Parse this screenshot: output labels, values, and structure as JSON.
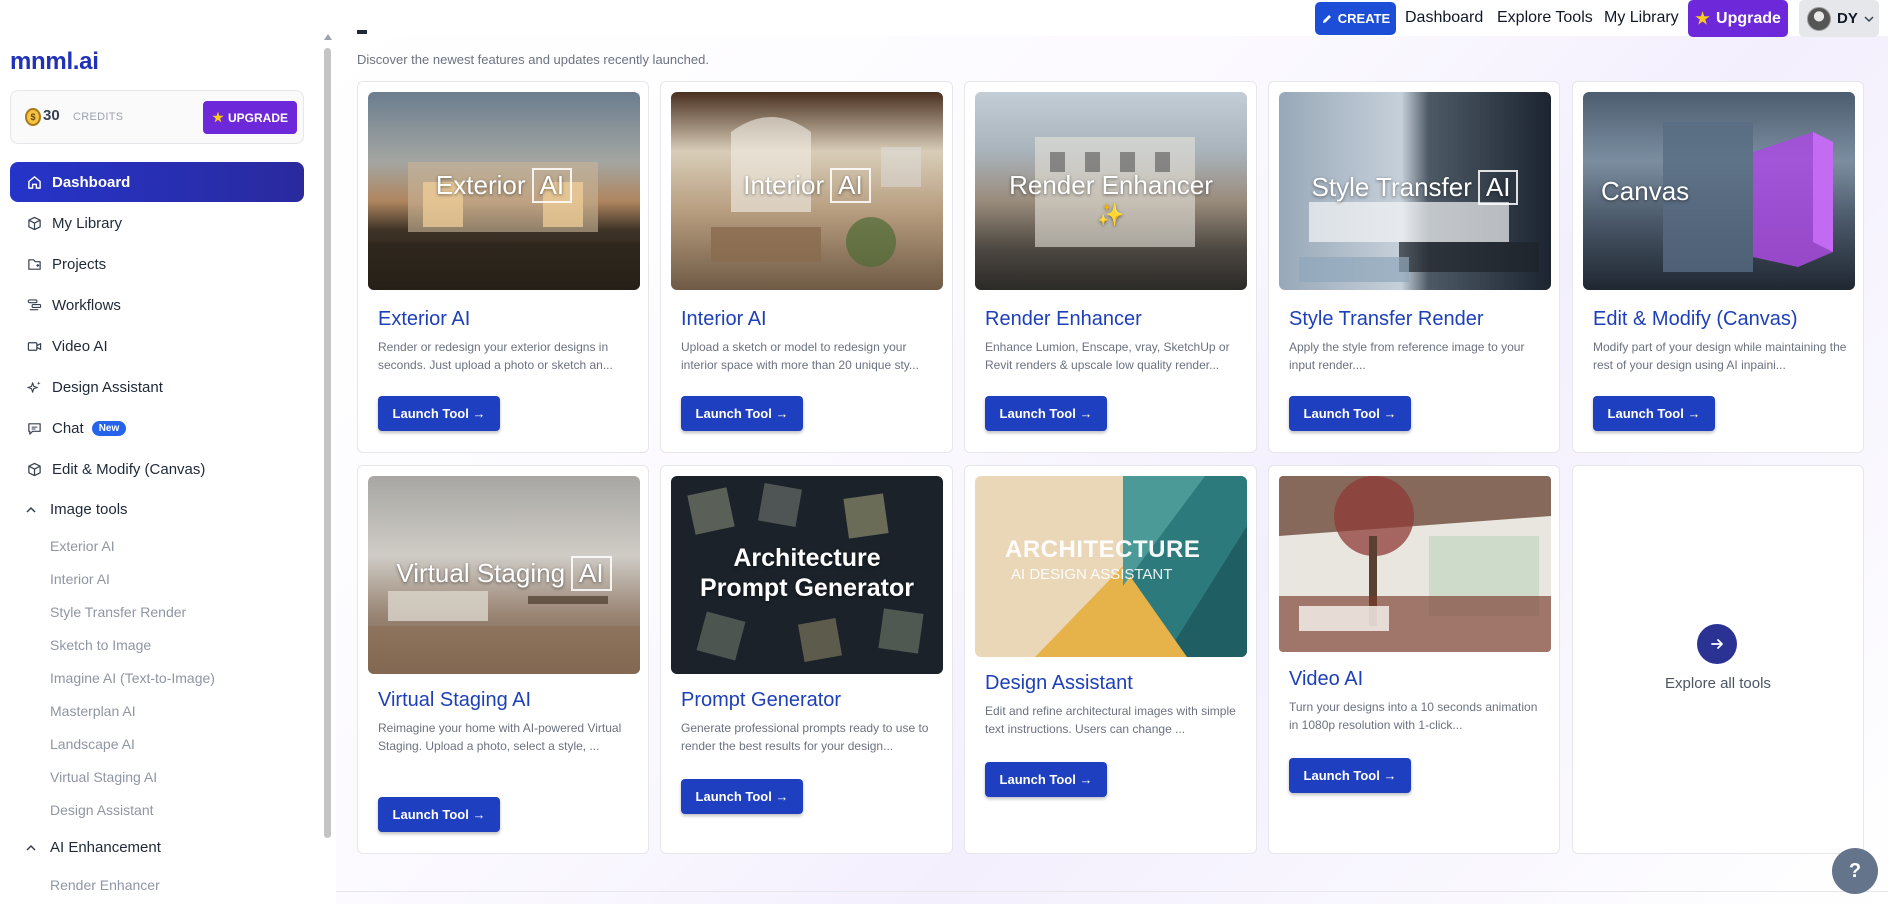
{
  "app": {
    "logo": "mnml.ai"
  },
  "credits": {
    "amount": "30",
    "label": "CREDITS",
    "upgrade_label": "UPGRADE"
  },
  "topbar": {
    "create_label": "CREATE",
    "links": [
      "Dashboard",
      "Explore Tools",
      "My Library"
    ],
    "upgrade_label": "Upgrade",
    "user_initials": "DY"
  },
  "sidebar": {
    "items": [
      {
        "label": "Dashboard",
        "icon": "home-icon",
        "active": true
      },
      {
        "label": "My Library",
        "icon": "cube-icon"
      },
      {
        "label": "Projects",
        "icon": "folder-icon"
      },
      {
        "label": "Workflows",
        "icon": "workflow-icon"
      },
      {
        "label": "Video AI",
        "icon": "video-icon"
      },
      {
        "label": "Design Assistant",
        "icon": "sparkles-icon"
      },
      {
        "label": "Chat",
        "icon": "chat-icon",
        "badge": "New"
      },
      {
        "label": "Edit & Modify (Canvas)",
        "icon": "box-icon"
      }
    ],
    "image_tools": {
      "label": "Image tools",
      "items": [
        "Exterior AI",
        "Interior AI",
        "Style Transfer Render",
        "Sketch to Image",
        "Imagine AI (Text-to-Image)",
        "Masterplan AI",
        "Landscape AI",
        "Virtual Staging AI",
        "Design Assistant"
      ]
    },
    "ai_enhancement": {
      "label": "AI Enhancement",
      "items": [
        "Render Enhancer"
      ]
    }
  },
  "main": {
    "subheading": "Discover the newest features and updates recently launched.",
    "launch_label": "Launch Tool →",
    "cards": [
      {
        "title": "Exterior AI",
        "desc": "Render or redesign your exterior designs in seconds. Just upload a photo or sketch an...",
        "img_text": "Exterior",
        "img_ai": "AI"
      },
      {
        "title": "Interior AI",
        "desc": "Upload a sketch or model to redesign your interior space with more than 20 unique sty...",
        "img_text": "Interior",
        "img_ai": "AI"
      },
      {
        "title": "Render Enhancer",
        "desc": "Enhance Lumion, Enscape, vray, SketchUp or Revit renders & upscale low quality render...",
        "img_text": "Render Enhancer",
        "img_sparkle": "✨"
      },
      {
        "title": "Style Transfer Render",
        "desc": "Apply the style from reference image to your input render....",
        "img_text": "Style Transfer",
        "img_ai": "AI"
      },
      {
        "title": "Edit & Modify (Canvas)",
        "desc": "Modify part of your design while maintaining the rest of your design using AI inpaini...",
        "img_text": "Canvas"
      },
      {
        "title": "Virtual Staging AI",
        "desc": "Reimagine your home with AI-powered Virtual Staging. Upload a photo, select a style, ...",
        "img_text": "Virtual Staging",
        "img_ai": "AI"
      },
      {
        "title": "Prompt Generator",
        "desc": "Generate professional prompts ready to use to render the best results for your design...",
        "img_text_1": "Architecture",
        "img_text_2": "Prompt Generator"
      },
      {
        "title": "Design Assistant",
        "desc": "Edit and refine architectural images with simple text instructions. Users can change ...",
        "img_text_1": "ARCHITECTURE",
        "img_text_2": "AI DESIGN ASSISTANT"
      },
      {
        "title": "Video AI",
        "desc": "Turn your designs into a 10 seconds animation in 1080p resolution with 1-click..."
      }
    ],
    "explore_label": "Explore all tools"
  },
  "help": {
    "label": "?"
  }
}
